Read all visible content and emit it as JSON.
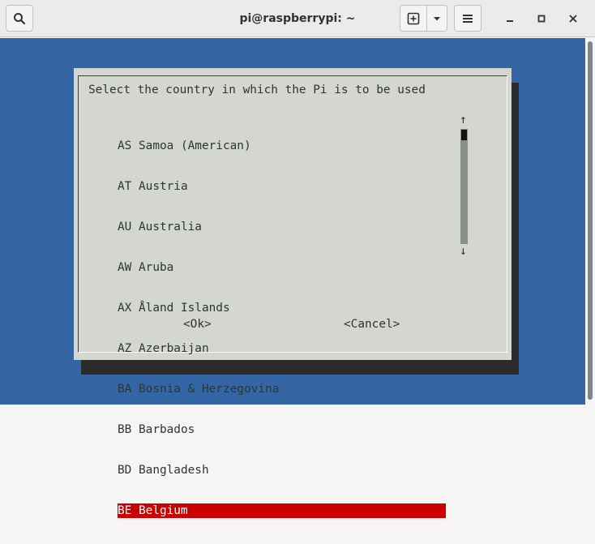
{
  "titlebar": {
    "title": "pi@raspberrypi: ~",
    "search_icon": "search-icon",
    "new_tab_icon": "new-tab-icon",
    "dropdown_icon": "chevron-down-icon",
    "menu_icon": "hamburger-menu-icon",
    "minimize_icon": "minimize-icon",
    "maximize_icon": "maximize-icon",
    "close_icon": "close-icon"
  },
  "dialog": {
    "prompt": "Select the country in which the Pi is to be used",
    "items": [
      "AS Samoa (American)",
      "AT Austria",
      "AU Australia",
      "AW Aruba",
      "AX Åland Islands",
      "AZ Azerbaijan",
      "BA Bosnia & Herzegovina",
      "BB Barbados",
      "BD Bangladesh",
      "BE Belgium"
    ],
    "selected_index": 9,
    "scroll_up": "↑",
    "scroll_down": "↓",
    "ok_label": "<Ok>",
    "cancel_label": "<Cancel>"
  },
  "colors": {
    "terminal_bg": "#3465a4",
    "dialog_bg": "#d3d7cf",
    "selection_bg": "#cc0000",
    "shadow": "#2b2b2b"
  }
}
